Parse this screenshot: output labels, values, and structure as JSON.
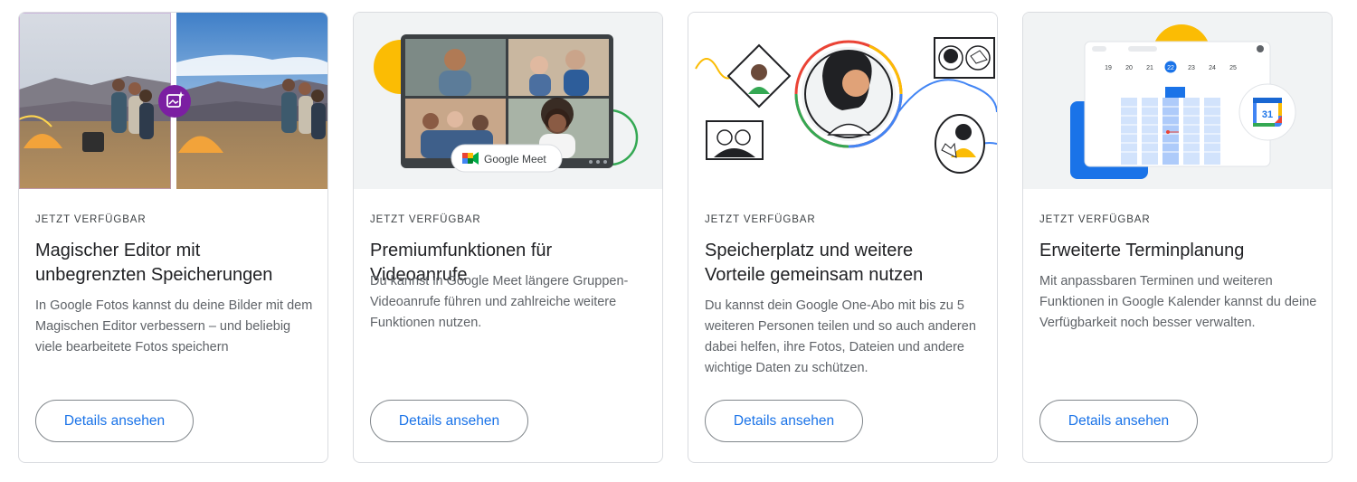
{
  "cards": [
    {
      "eyebrow": "JETZT VERFÜGBAR",
      "title": "Magischer Editor mit unbegrenzten Speicherungen",
      "description": "In Google Fotos kannst du deine Bilder mit dem Magischen Editor verbessern – und beliebig viele bearbeitete Fotos speichern",
      "button": "Details ansehen",
      "image_icon": "magic-editor-icon"
    },
    {
      "eyebrow": "JETZT VERFÜGBAR",
      "title": "Premiumfunktionen für Videoanrufe",
      "description": "Du kannst in Google Meet längere Gruppen-Videoanrufe führen und zahlreiche weitere Funktionen nutzen.",
      "button": "Details ansehen",
      "badge": "Google Meet",
      "image_icon": "google-meet-icon"
    },
    {
      "eyebrow": "JETZT VERFÜGBAR",
      "title": "Speicherplatz und weitere Vorteile gemeinsam nutzen",
      "description": "Du kannst dein Google One-Abo mit bis zu 5 weiteren Personen teilen und so auch anderen dabei helfen, ihre Fotos, Dateien und andere wichtige Daten zu schützen.",
      "button": "Details ansehen",
      "image_icon": "family-sharing-illustration"
    },
    {
      "eyebrow": "JETZT VERFÜGBAR",
      "title": "Erweiterte Terminplanung",
      "description": "Mit anpassbaren Terminen und weiteren Funktionen in Google Kalender kannst du deine Verfügbarkeit noch besser verwalten.",
      "button": "Details ansehen",
      "calendar": {
        "days": [
          "19",
          "20",
          "21",
          "22",
          "23",
          "24",
          "25"
        ],
        "selected_day": "22",
        "icon_number": "31"
      },
      "image_icon": "google-calendar-icon"
    }
  ],
  "colors": {
    "google_blue": "#4285f4",
    "google_red": "#ea4335",
    "google_yellow": "#fbbc04",
    "google_green": "#34a853",
    "link_blue": "#1a73e8",
    "purple_badge": "#7b1fa2"
  }
}
